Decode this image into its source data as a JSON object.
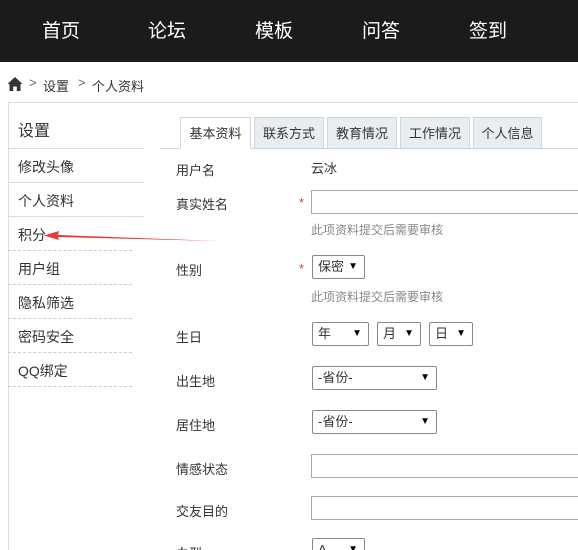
{
  "topnav": {
    "items": [
      {
        "label": "首页"
      },
      {
        "label": "论坛"
      },
      {
        "label": "模板"
      },
      {
        "label": "问答"
      },
      {
        "label": "签到"
      }
    ]
  },
  "breadcrumb": {
    "icon": "home-icon",
    "separator": ">",
    "items": [
      "设置",
      "个人资料"
    ]
  },
  "sidebar": {
    "title": "设置",
    "items": [
      {
        "label": "修改头像"
      },
      {
        "label": "个人资料"
      },
      {
        "label": "积分"
      },
      {
        "label": "用户组"
      },
      {
        "label": "隐私筛选"
      },
      {
        "label": "密码安全"
      },
      {
        "label": "QQ绑定"
      }
    ]
  },
  "tabs": [
    {
      "label": "基本资料",
      "active": true
    },
    {
      "label": "联系方式"
    },
    {
      "label": "教育情况"
    },
    {
      "label": "工作情况"
    },
    {
      "label": "个人信息"
    }
  ],
  "form": {
    "required_mark": "*",
    "username": {
      "label": "用户名",
      "value": "云冰"
    },
    "realname": {
      "label": "真实姓名",
      "value": "",
      "hint": "此项资料提交后需要审核"
    },
    "gender": {
      "label": "性别",
      "value": "保密",
      "hint": "此项资料提交后需要审核"
    },
    "birthday": {
      "label": "生日",
      "year": "年",
      "month": "月",
      "day": "日"
    },
    "birthplace": {
      "label": "出生地",
      "value": "-省份-"
    },
    "residence": {
      "label": "居住地",
      "value": "-省份-"
    },
    "relationship": {
      "label": "情感状态",
      "value": ""
    },
    "purpose": {
      "label": "交友目的",
      "value": ""
    },
    "blood": {
      "label": "血型",
      "value": "A"
    }
  },
  "annotation": {
    "color": "#e53935",
    "points_to": "积分"
  }
}
